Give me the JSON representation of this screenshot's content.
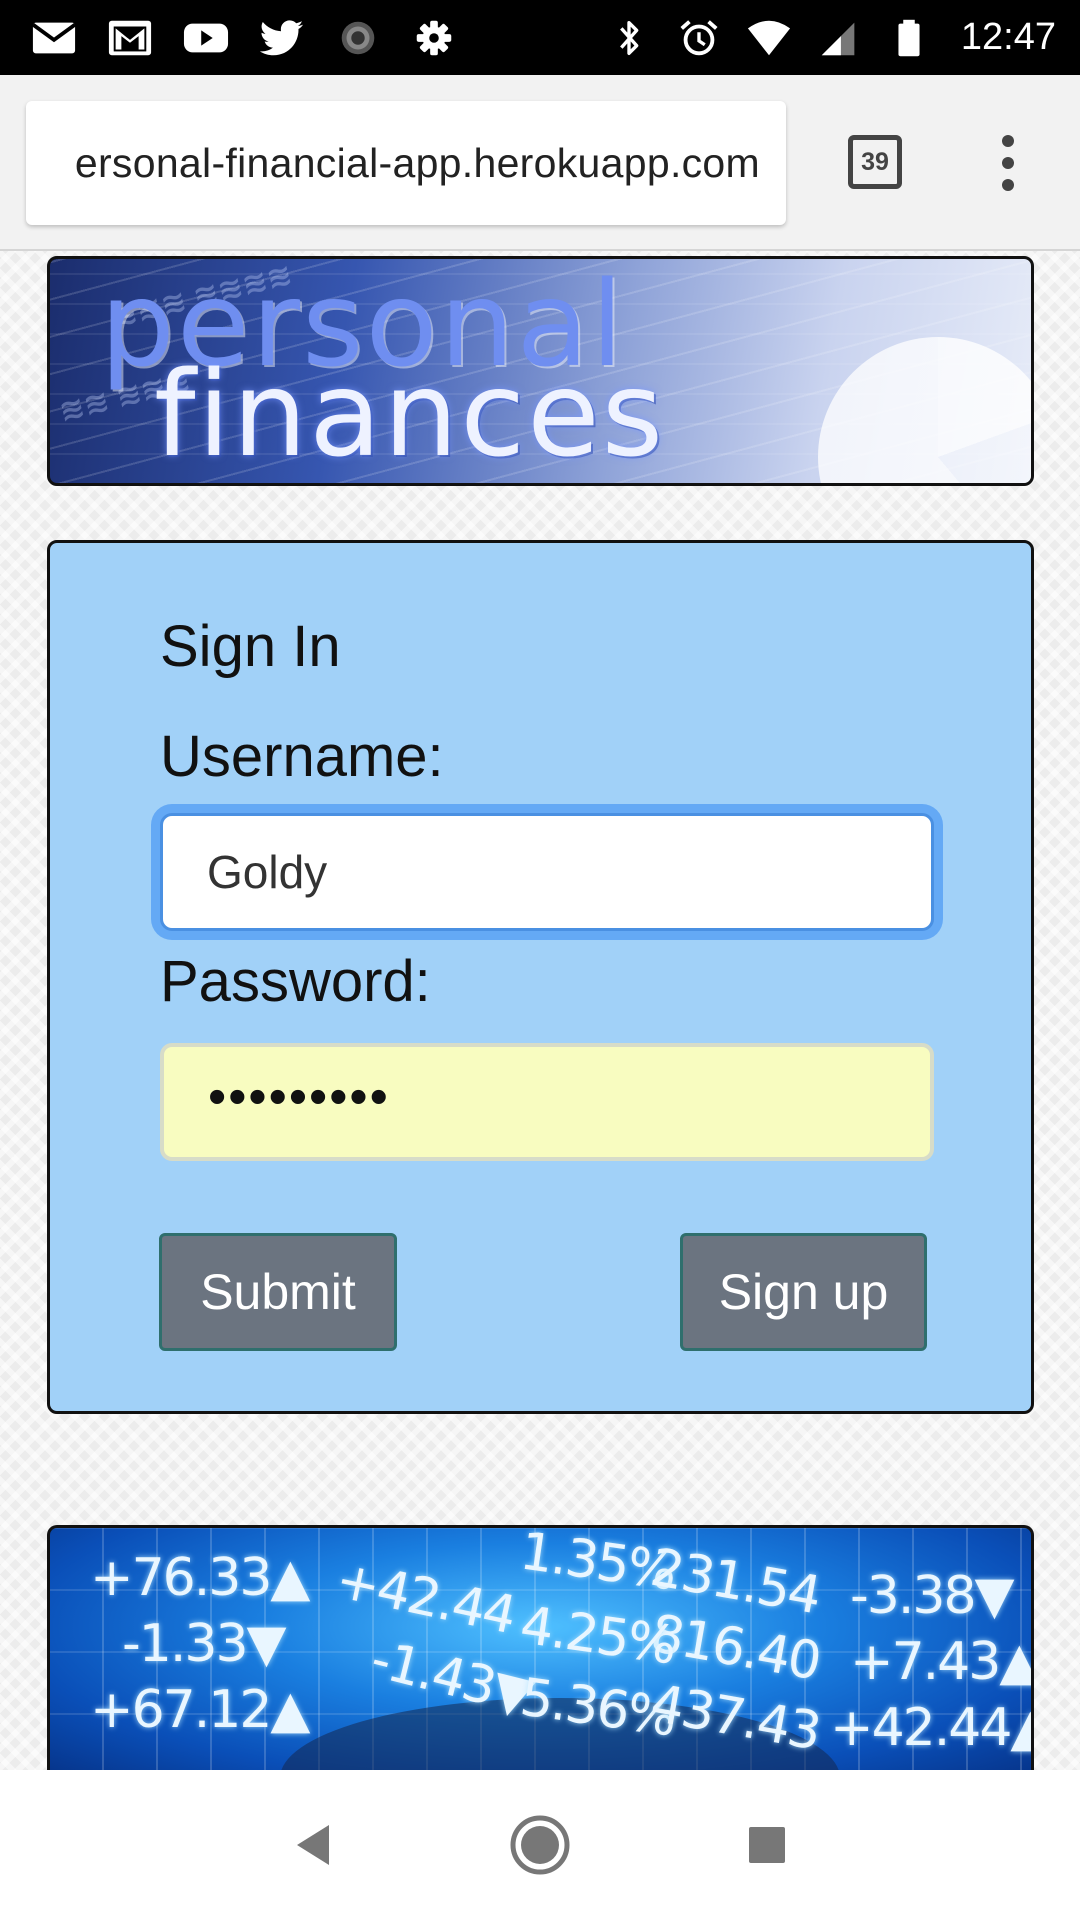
{
  "status_bar": {
    "time": "12:47",
    "left_icons": [
      "mail-icon",
      "gmail-icon",
      "youtube-icon",
      "twitter-icon",
      "sync-icon",
      "settings-icon"
    ],
    "right_icons": [
      "bluetooth-icon",
      "alarm-icon",
      "wifi-icon",
      "signal-icon",
      "battery-icon"
    ]
  },
  "browser": {
    "url": "ersonal-financial-app.herokuapp.com",
    "tab_count": "39"
  },
  "banner": {
    "line1": "personal",
    "line2": "finances"
  },
  "form": {
    "title": "Sign In",
    "username_label": "Username:",
    "username_value": "Goldy",
    "password_label": "Password:",
    "password_value": "•••••••••",
    "submit_label": "Submit",
    "signup_label": "Sign up"
  },
  "stock_image": {
    "tickers": [
      "+76.33▲",
      "-1.33▼",
      "+67.12▲",
      "+42.44",
      "1.35%",
      "231.54",
      "816.40",
      "-1.43▼",
      "5.36%",
      "437.43",
      "-3.38▼",
      "+7.43▲",
      "+42.44▲",
      "4.25%",
      "+76.33"
    ]
  },
  "colors": {
    "panel_bg": "#a1d1f8",
    "button_bg": "#6b7480",
    "password_bg": "#f8fcc0",
    "focus_ring": "#64a9f5"
  }
}
